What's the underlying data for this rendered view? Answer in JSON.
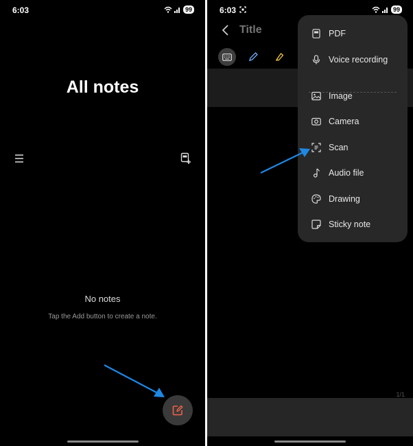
{
  "left": {
    "status": {
      "time": "6:03",
      "battery": "99"
    },
    "title": "All notes",
    "empty_title": "No notes",
    "empty_hint": "Tap the Add button to create a note."
  },
  "right": {
    "status": {
      "time": "6:03",
      "battery": "99"
    },
    "title_placeholder": "Title",
    "page_indicator": "1/1",
    "menu": {
      "items": [
        {
          "label": "PDF",
          "icon": "pdf-icon"
        },
        {
          "label": "Voice recording",
          "icon": "microphone-icon"
        },
        {
          "label": "Image",
          "icon": "image-icon"
        },
        {
          "label": "Camera",
          "icon": "camera-icon"
        },
        {
          "label": "Scan",
          "icon": "scan-icon"
        },
        {
          "label": "Audio file",
          "icon": "music-note-icon"
        },
        {
          "label": "Drawing",
          "icon": "palette-icon"
        },
        {
          "label": "Sticky note",
          "icon": "sticky-note-icon"
        }
      ]
    }
  },
  "colors": {
    "background": "#000000",
    "fab_icon": "#f0624b",
    "annotation_arrow": "#1e88e5",
    "menu_background": "#282828"
  }
}
